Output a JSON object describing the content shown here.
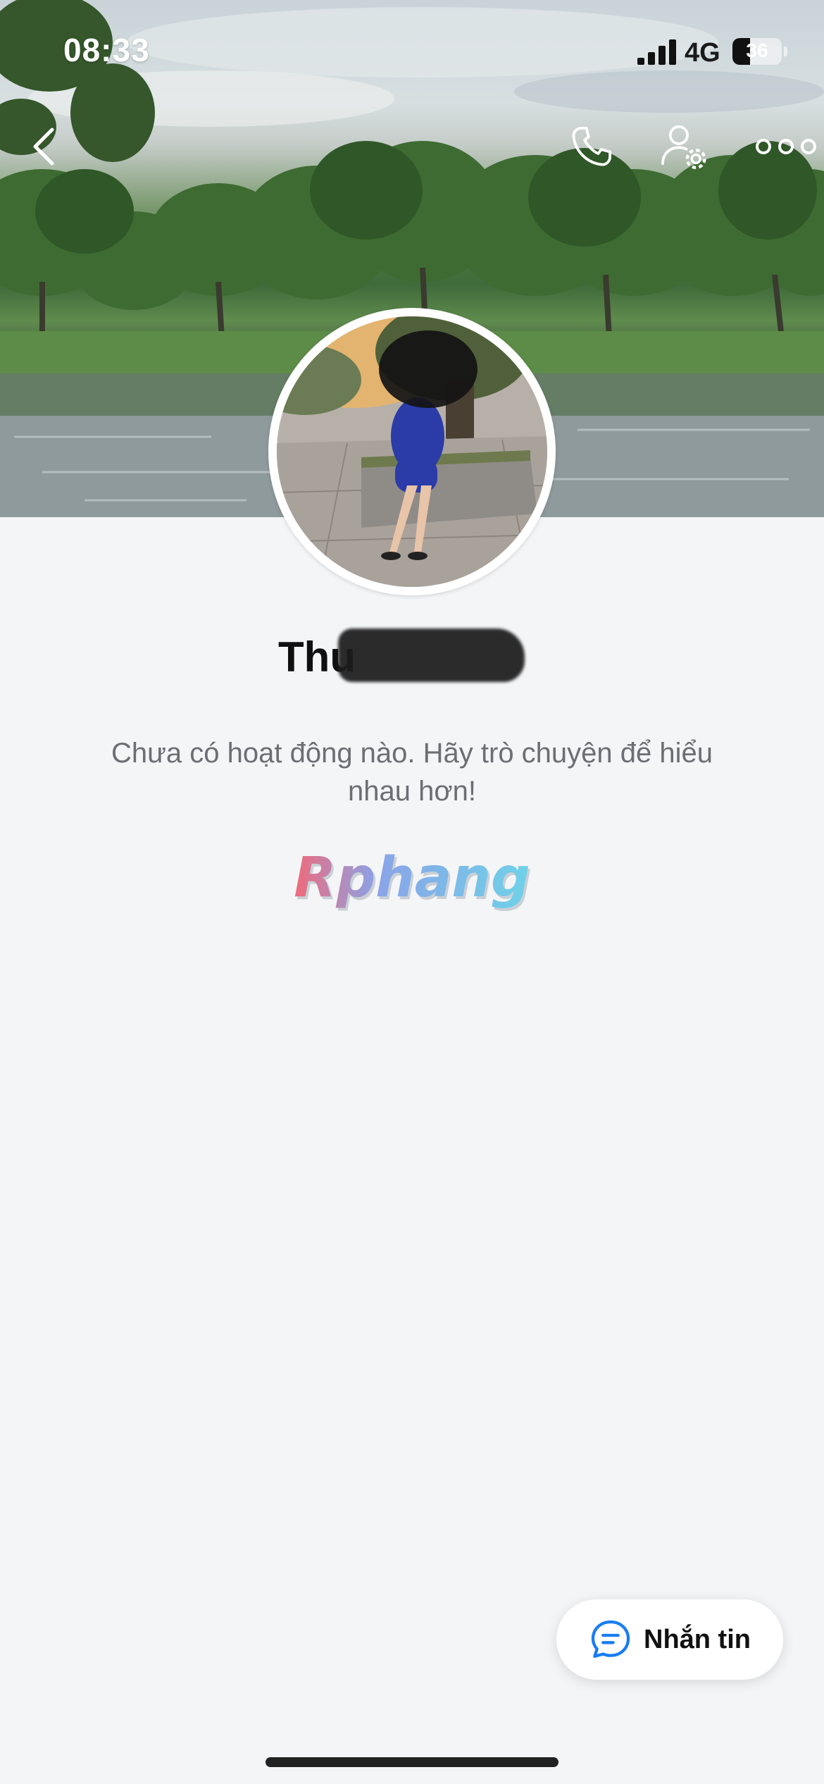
{
  "status_bar": {
    "time": "08:33",
    "network": "4G",
    "battery": "36",
    "battery_level": 0.36
  },
  "nav": {
    "back_icon": "chevron-left-icon",
    "call_icon": "phone-icon",
    "profile_settings_icon": "user-gear-icon",
    "more_icon": "more-horizontal-icon"
  },
  "profile": {
    "name_visible": "Thu"
  },
  "empty_state": {
    "message": "Chưa có hoạt động nào. Hãy trò chuyện để hiểu nhau hơn!"
  },
  "watermark": {
    "text": "Rphang"
  },
  "message_button": {
    "label": "Nhắn tin",
    "icon": "chat-bubble-icon"
  },
  "colors": {
    "accent": "#1a7cf2",
    "background": "#f4f5f7",
    "text_secondary": "#6b6e73"
  }
}
